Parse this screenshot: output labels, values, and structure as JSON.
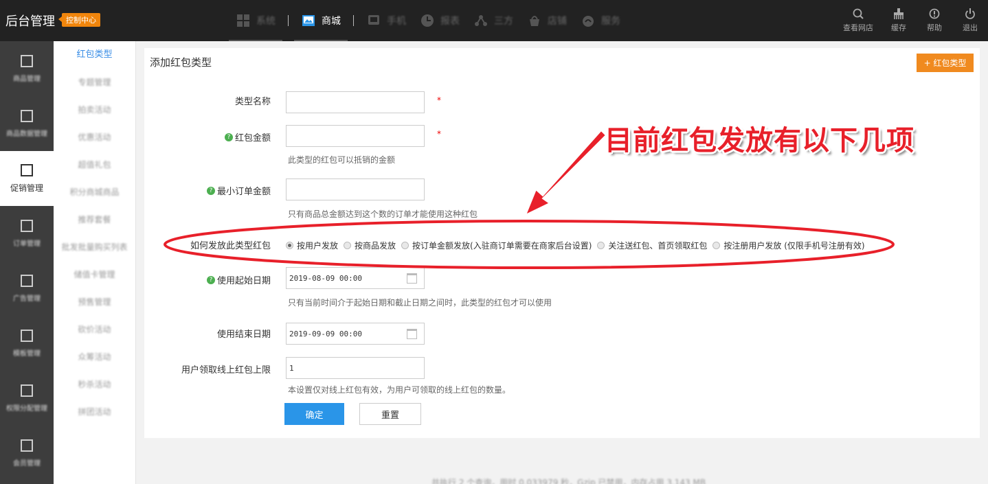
{
  "brand": {
    "title": "后台管理",
    "badge": "控制中心"
  },
  "nav": [
    {
      "label": "系统",
      "icon": "grid-icon"
    },
    {
      "label": "商城",
      "icon": "image-icon",
      "active": true
    },
    {
      "label": "手机",
      "icon": "monitor-icon"
    },
    {
      "label": "报表",
      "icon": "clock-icon"
    },
    {
      "label": "三方",
      "icon": "network-icon"
    },
    {
      "label": "店铺",
      "icon": "shop-icon"
    },
    {
      "label": "服务",
      "icon": "cloud-icon"
    }
  ],
  "tools": [
    {
      "label": "查看网店",
      "icon": "search-icon"
    },
    {
      "label": "缓存",
      "icon": "broom-icon"
    },
    {
      "label": "帮助",
      "icon": "info-icon"
    },
    {
      "label": "退出",
      "icon": "power-icon"
    }
  ],
  "sidebar": [
    {
      "label": "商品管理"
    },
    {
      "label": "商品数据管理"
    },
    {
      "label": "促销管理",
      "active": true
    },
    {
      "label": "订单管理"
    },
    {
      "label": "广告管理"
    },
    {
      "label": "模板管理"
    },
    {
      "label": "权限分配管理"
    },
    {
      "label": "会员管理"
    }
  ],
  "submenu": [
    {
      "label": "红包类型",
      "active": true
    },
    {
      "label": "专题管理"
    },
    {
      "label": "拍卖活动"
    },
    {
      "label": "优惠活动"
    },
    {
      "label": "超值礼包"
    },
    {
      "label": "积分商城商品"
    },
    {
      "label": "推荐套餐"
    },
    {
      "label": "批发批量购买列表"
    },
    {
      "label": "储值卡管理"
    },
    {
      "label": "预售管理"
    },
    {
      "label": "砍价活动"
    },
    {
      "label": "众筹活动"
    },
    {
      "label": "秒杀活动"
    },
    {
      "label": "拼团活动"
    }
  ],
  "page": {
    "title": "添加红包类型",
    "add_button": "+ 红包类型"
  },
  "form": {
    "type_name_label": "类型名称",
    "type_name_value": "",
    "amount_label": "红包金额",
    "amount_value": "",
    "amount_hint": "此类型的红包可以抵销的金额",
    "min_order_label": "最小订单金额",
    "min_order_value": "",
    "min_order_hint": "只有商品总金额达到这个数的订单才能使用这种红包",
    "send_method_label": "如何发放此类型红包",
    "send_options": [
      {
        "label": "按用户发放",
        "checked": true
      },
      {
        "label": "按商品发放",
        "checked": false
      },
      {
        "label": "按订单金额发放(入驻商订单需要在商家后台设置)",
        "checked": false
      },
      {
        "label": "关注送红包、首页领取红包",
        "checked": false
      },
      {
        "label": "按注册用户发放 (仅限手机号注册有效)",
        "checked": false
      }
    ],
    "start_date_label": "使用起始日期",
    "start_date_value": "2019-08-09 00:00",
    "date_hint": "只有当前时间介于起始日期和截止日期之间时，此类型的红包才可以使用",
    "end_date_label": "使用结束日期",
    "end_date_value": "2019-09-09 00:00",
    "limit_label": "用户领取线上红包上限",
    "limit_value": "1",
    "limit_hint": "本设置仅对线上红包有效，为用户可领取的线上红包的数量。",
    "required_mark": "*",
    "help_mark": "?",
    "ok_button": "确定",
    "reset_button": "重置"
  },
  "footer": "共执行 2 个查询，用时 0.033979 秒，Gzip 已禁用，内存占用 3.143 MB",
  "annotation": {
    "text": "目前红包发放有以下几项",
    "color": "#e8202a"
  }
}
